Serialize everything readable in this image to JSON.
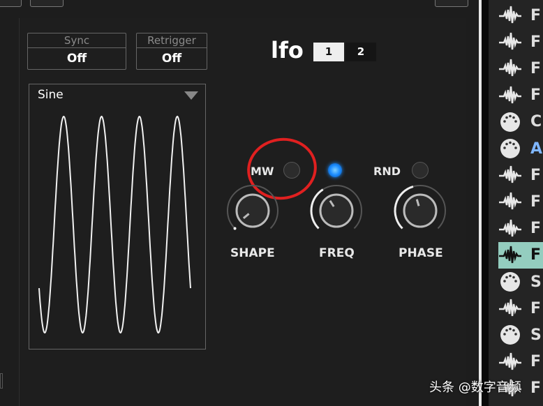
{
  "lfo": {
    "title": "lfo",
    "tabs": [
      "1",
      "2"
    ],
    "active_tab": "1"
  },
  "sync": {
    "label": "Sync",
    "value": "Off"
  },
  "retrigger": {
    "label": "Retrigger",
    "value": "Off"
  },
  "waveform": {
    "selected": "Sine",
    "cycles": 4
  },
  "mw": {
    "label": "MW",
    "on": false
  },
  "freq_led": {
    "on": true
  },
  "rnd": {
    "label": "RND",
    "on": false
  },
  "knobs": [
    {
      "label": "SHAPE",
      "value": 0.02
    },
    {
      "label": "FREQ",
      "value": 0.38
    },
    {
      "label": "PHASE",
      "value": 0.44
    }
  ],
  "highlight_color": "#e02020",
  "tracks": [
    {
      "icon": "audio-wave-icon",
      "letter": "F"
    },
    {
      "icon": "audio-wave-icon",
      "letter": "F"
    },
    {
      "icon": "audio-wave-icon",
      "letter": "F"
    },
    {
      "icon": "audio-wave-icon",
      "letter": "F"
    },
    {
      "icon": "midi-port-icon",
      "letter": "C"
    },
    {
      "icon": "midi-port-icon",
      "letter": "A"
    },
    {
      "icon": "audio-wave-icon",
      "letter": "F"
    },
    {
      "icon": "audio-wave-icon",
      "letter": "F"
    },
    {
      "icon": "audio-wave-icon",
      "letter": "F"
    },
    {
      "icon": "audio-wave-icon",
      "letter": "F",
      "selected": true
    },
    {
      "icon": "midi-port-icon",
      "letter": "S"
    },
    {
      "icon": "audio-wave-icon",
      "letter": "F"
    },
    {
      "icon": "midi-port-icon",
      "letter": "S"
    },
    {
      "icon": "audio-wave-icon",
      "letter": "F"
    },
    {
      "icon": "audio-wave-icon",
      "letter": "F"
    }
  ],
  "watermark": "头条 @数字音频"
}
